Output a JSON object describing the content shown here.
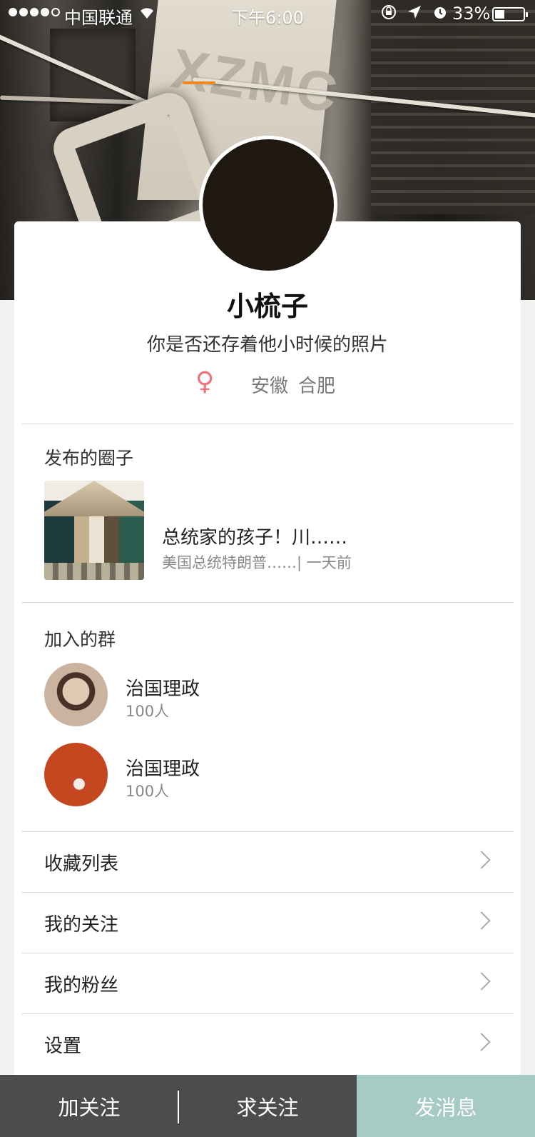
{
  "status_bar": {
    "carrier": "中国联通",
    "time": "下午6:00",
    "battery_percent_text": "33%",
    "battery_level": 0.33,
    "icons": [
      "signal-icon",
      "wifi-icon",
      "rotation-lock-icon",
      "location-arrow-icon",
      "alarm-icon",
      "battery-icon"
    ]
  },
  "cover": {
    "sign_text": "XZMC"
  },
  "profile": {
    "name": "小梳子",
    "bio": "你是否还存着他小时候的照片",
    "gender_icon": "female-icon",
    "gender_symbol": "♀",
    "gender_color": "#f0707c",
    "province": "安徽",
    "city": "合肥"
  },
  "posts_section": {
    "title": "发布的圈子",
    "items": [
      {
        "title": "总统家的孩子！川……",
        "meta": "美国总统特朗普……| 一天前"
      }
    ]
  },
  "groups_section": {
    "title": "加入的群",
    "items": [
      {
        "name": "治国理政",
        "members": "100人"
      },
      {
        "name": "治国理政",
        "members": "100人"
      }
    ]
  },
  "menu": [
    {
      "label": "收藏列表"
    },
    {
      "label": "我的关注"
    },
    {
      "label": "我的粉丝"
    },
    {
      "label": "设置"
    }
  ],
  "bottom_bar": {
    "follow_label": "加关注",
    "ask_follow_label": "求关注",
    "message_label": "发消息",
    "accent_color": "#a6cbc3",
    "bar_color": "#4c4c4e"
  }
}
